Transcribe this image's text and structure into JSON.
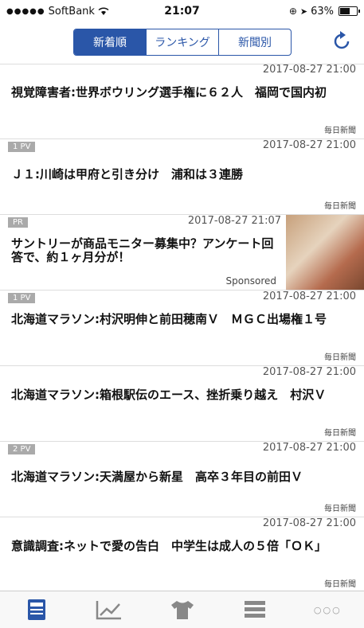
{
  "status": {
    "carrier": "SoftBank",
    "time": "21:07",
    "battery": "63%"
  },
  "tabs": [
    "新着順",
    "ランキング",
    "新聞別"
  ],
  "articles": [
    {
      "pv": "",
      "date": "2017-08-27 21:00",
      "title": "視覚障害者:世界ボウリング選手権に６２人　福岡で国内初",
      "source": "毎日新聞"
    },
    {
      "pv": "1 PV",
      "date": "2017-08-27 21:00",
      "title": "Ｊ１:川崎は甲府と引き分け　浦和は３連勝",
      "source": "毎日新聞"
    },
    {
      "pv": "",
      "date": "2017-08-27 21:00",
      "title": "北海道マラソン:村沢明伸と前田穂南Ｖ　ＭＧＣ出場権１号",
      "source": "毎日新聞"
    },
    {
      "pv": "",
      "date": "2017-08-27 21:00",
      "title": "北海道マラソン:箱根駅伝のエース、挫折乗り越え　村沢Ｖ",
      "source": "毎日新聞"
    },
    {
      "pv": "2 PV",
      "date": "2017-08-27 21:00",
      "title": "北海道マラソン:天満屋から新星　高卒３年目の前田Ｖ",
      "source": "毎日新聞"
    },
    {
      "pv": "",
      "date": "2017-08-27 21:00",
      "title": "意識調査:ネットで愛の告白　中学生は成人の５倍「ＯＫ」",
      "source": "毎日新聞"
    }
  ],
  "ad": {
    "pr": "PR",
    "date": "2017-08-27 21:07",
    "title": "サントリーが商品モニター募集中？アンケート回答で、約１ヶ月分が！",
    "sponsored": "Sponsored"
  },
  "ad_pv": "1 PV",
  "more_label": "○○○"
}
